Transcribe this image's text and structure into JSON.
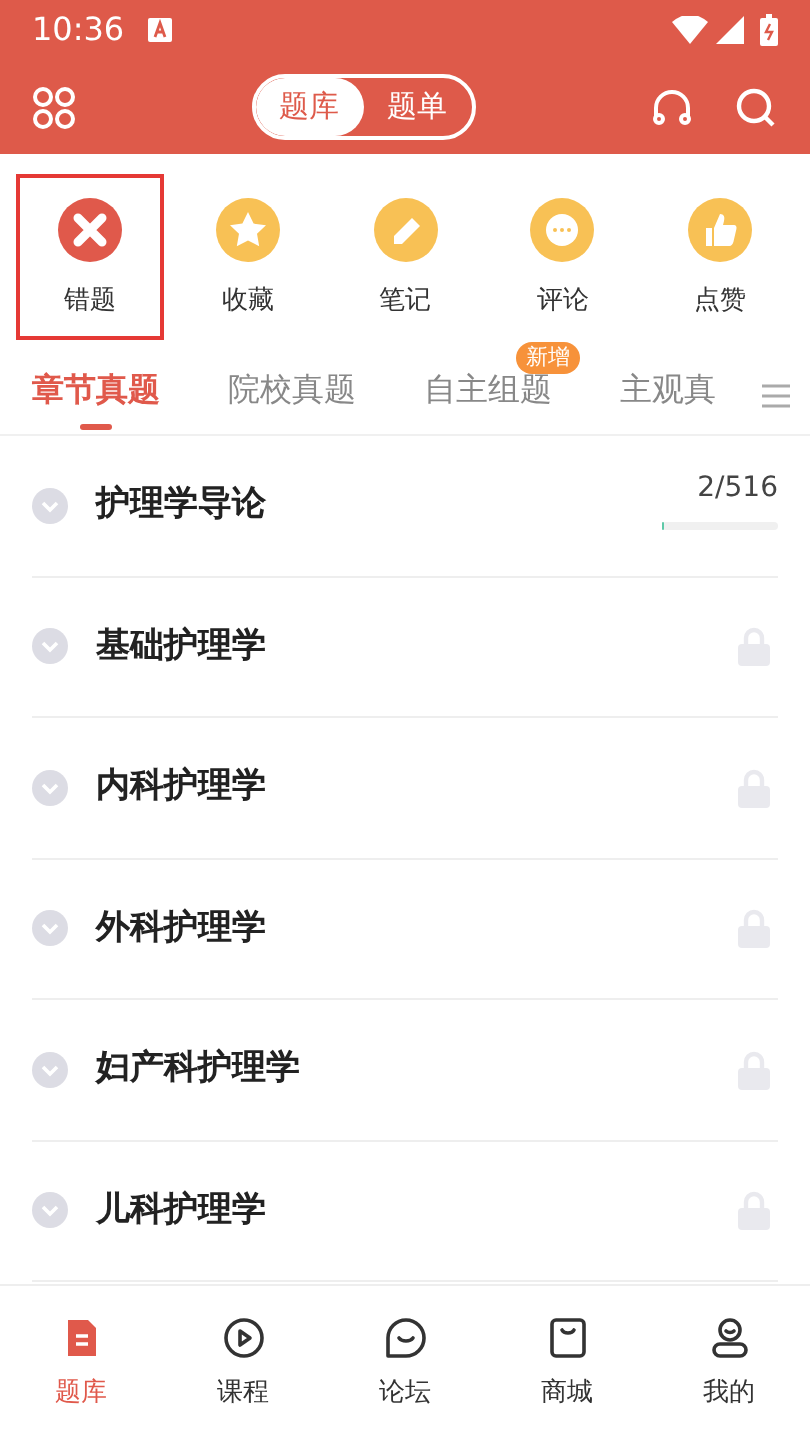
{
  "status_bar": {
    "time": "10:36"
  },
  "header": {
    "segments": [
      {
        "label": "题库",
        "selected": true
      },
      {
        "label": "题单",
        "selected": false
      }
    ]
  },
  "shortcuts": [
    {
      "label": "错题",
      "kind": "wrong",
      "selected": true
    },
    {
      "label": "收藏",
      "kind": "star",
      "selected": false
    },
    {
      "label": "笔记",
      "kind": "note",
      "selected": false
    },
    {
      "label": "评论",
      "kind": "comment",
      "selected": false
    },
    {
      "label": "点赞",
      "kind": "like",
      "selected": false
    }
  ],
  "tabs": [
    {
      "label": "章节真题",
      "selected": true
    },
    {
      "label": "院校真题",
      "selected": false
    },
    {
      "label": "自主组题",
      "selected": false,
      "badge": "新增"
    },
    {
      "label": "主观真",
      "selected": false
    }
  ],
  "chapters": [
    {
      "title": "护理学导论",
      "kind": "progress",
      "reading": "2/516",
      "level": 0.02
    },
    {
      "title": "基础护理学",
      "kind": "locked"
    },
    {
      "title": "内科护理学",
      "kind": "locked"
    },
    {
      "title": "外科护理学",
      "kind": "locked"
    },
    {
      "title": "妇产科护理学",
      "kind": "locked"
    },
    {
      "title": "儿科护理学",
      "kind": "locked"
    }
  ],
  "bottom_nav": [
    {
      "label": "题库",
      "kind": "bank",
      "selected": true
    },
    {
      "label": "课程",
      "kind": "course",
      "selected": false
    },
    {
      "label": "论坛",
      "kind": "forum",
      "selected": false
    },
    {
      "label": "商城",
      "kind": "shop",
      "selected": false
    },
    {
      "label": "我的",
      "kind": "me",
      "selected": false
    }
  ]
}
